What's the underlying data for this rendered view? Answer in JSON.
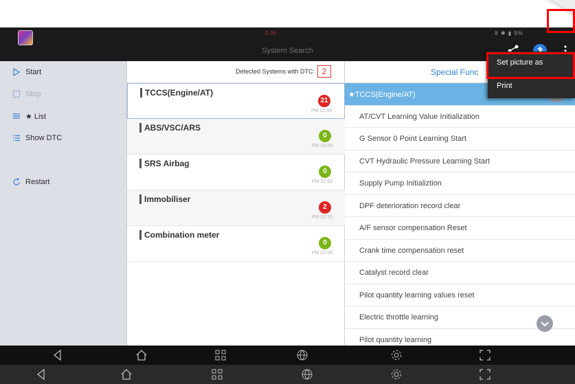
{
  "status_bar": {
    "center_text": "0.0V",
    "right_text": "8 ✱ ▮ 9%"
  },
  "title_bar": {
    "title": "System Search"
  },
  "sidebar": {
    "items": [
      {
        "label": "Start",
        "icon": "play-outline-icon",
        "enabled": true
      },
      {
        "label": "Stop",
        "icon": "stop-square-icon",
        "enabled": false
      },
      {
        "label": "★ List",
        "icon": "list-icon",
        "enabled": true
      },
      {
        "label": "Show DTC",
        "icon": "dtc-list-icon",
        "enabled": true
      },
      {
        "label": "Restart",
        "icon": "restart-icon",
        "enabled": true
      }
    ]
  },
  "systems": {
    "header_label": "Detected Systems with DTC:",
    "dtc_count": "2",
    "rows": [
      {
        "name": "TCCS(Engine/AT)",
        "count": "21",
        "status": "red",
        "time": "PM 02:59"
      },
      {
        "name": "ABS/VSC/ARS",
        "count": "0",
        "status": "green",
        "time": "PM 02:59"
      },
      {
        "name": "SRS Airbag",
        "count": "0",
        "status": "green",
        "time": "PM 02:59"
      },
      {
        "name": "Immobiliser",
        "count": "2",
        "status": "red",
        "time": "PM 02:59"
      },
      {
        "name": "Combination meter",
        "count": "0",
        "status": "green",
        "time": "PM 02:59"
      }
    ]
  },
  "special_func": {
    "header_label": "Special Func",
    "items": [
      "★TCCS(Engine/AT)",
      "AT/CVT Learning Value Initialization",
      "G Sensor 0 Point Learning Start",
      "CVT Hydraulic Pressure Learning Start",
      "Supply Pump Initializtion",
      "DPF deterioration record clear",
      "A/F sensor compensation Reset",
      "Crank time compensation reset",
      "Catalyst record clear",
      "Pilot quantity learning values reset",
      "Electric throttle learning",
      "Pilot quantity learning"
    ]
  },
  "popup_menu": {
    "items": [
      "Set picture as",
      "Print"
    ]
  },
  "colors": {
    "accent_blue": "#2e84d3",
    "active_row": "#6ab3e4",
    "badge_red": "#e02424",
    "badge_green": "#7cb518",
    "highlight_red": "#ff0000",
    "bluetooth": "#2a7de1"
  }
}
